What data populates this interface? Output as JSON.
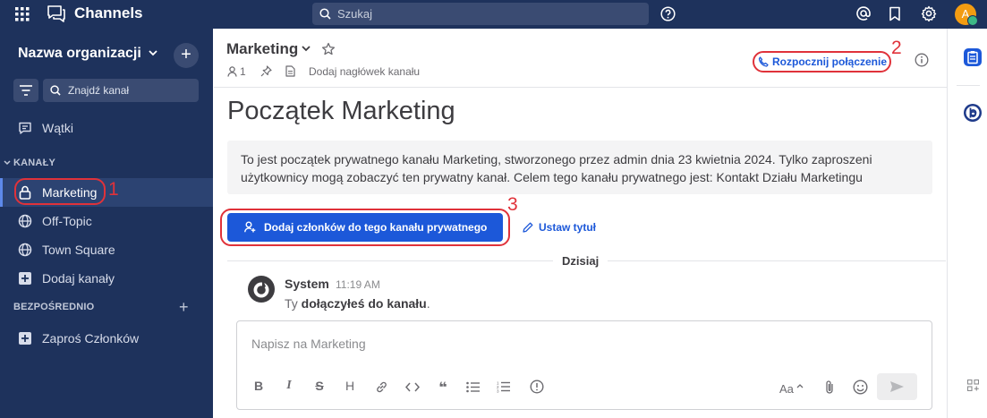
{
  "topbar": {
    "brand": "Channels",
    "search_placeholder": "Szukaj",
    "avatar_initial": "A"
  },
  "sidebar": {
    "org_name": "Nazwa organizacji",
    "find_channel": "Znajdź kanał",
    "threads": "Wątki",
    "section_channels": "KANAŁY",
    "channels": [
      {
        "label": "Marketing",
        "icon": "lock-icon",
        "active": true
      },
      {
        "label": "Off-Topic",
        "icon": "globe-icon"
      },
      {
        "label": "Town Square",
        "icon": "globe-icon"
      }
    ],
    "add_channels": "Dodaj kanały",
    "section_direct": "BEZPOŚREDNIO",
    "invite_members": "Zaproś Członków"
  },
  "header": {
    "channel_name": "Marketing",
    "member_count": "1",
    "add_header": "Dodaj nagłówek kanału",
    "start_call": "Rozpocznij połączenie"
  },
  "intro": {
    "title": "Początek Marketing",
    "description": "To jest początek prywatnego kanału Marketing, stworzonego przez admin dnia 23 kwietnia 2024. Tylko zaproszeni użytkownicy mogą zobaczyć ten prywatny kanał. Celem tego kanału prywatnego jest: Kontakt Działu Marketingu",
    "add_members_button": "Dodaj członków do tego kanału prywatnego",
    "set_title_button": "Ustaw tytuł"
  },
  "feed": {
    "date_divider": "Dzisiaj",
    "messages": [
      {
        "author": "System",
        "time": "11:19 AM",
        "text_prefix": "Ty ",
        "text_bold": "dołączyłeś do kanału",
        "text_suffix": "."
      }
    ]
  },
  "composer": {
    "placeholder": "Napisz na Marketing",
    "format_labels": {
      "bold": "B",
      "italic": "I",
      "strike": "S",
      "heading": "H",
      "quote": "❝",
      "font_size": "Aa"
    }
  },
  "annotations": [
    "1",
    "2",
    "3"
  ],
  "colors": {
    "sidebar_bg": "#1e325c",
    "accent": "#1c58d9",
    "annotation": "#e0323a",
    "online": "#3db887",
    "avatar": "#f39c12"
  }
}
